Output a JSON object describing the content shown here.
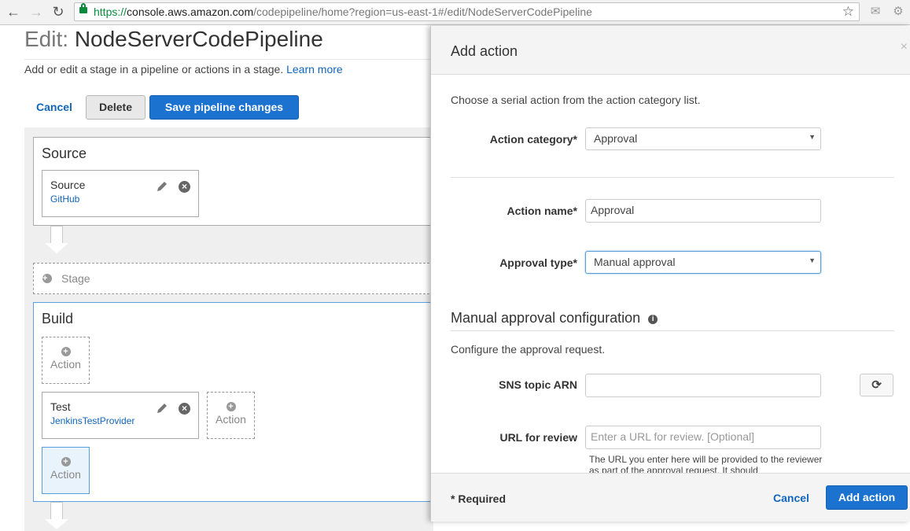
{
  "browser": {
    "url_scheme": "https://",
    "url_host": "console.aws.amazon.com",
    "url_path": "/codepipeline/home?region=us-east-1#/edit/NodeServerCodePipeline"
  },
  "page": {
    "title_prefix": "Edit: ",
    "title_name": "NodeServerCodePipeline",
    "subtitle": "Add or edit a stage in a pipeline or actions in a stage.",
    "learn_more": "Learn more",
    "cancel": "Cancel",
    "delete": "Delete",
    "save": "Save pipeline changes"
  },
  "pipeline": {
    "source_stage": {
      "title": "Source",
      "action_title": "Source",
      "action_provider": "GitHub"
    },
    "add_stage_label": "Stage",
    "build_stage": {
      "title": "Build",
      "action_title": "Test",
      "action_provider": "JenkinsTestProvider"
    },
    "add_action_label": "Action"
  },
  "modal": {
    "title": "Add action",
    "close": "×",
    "intro": "Choose a serial action from the action category list.",
    "category_label": "Action category*",
    "category_value": "Approval",
    "name_label": "Action name*",
    "name_value": "Approval",
    "approval_type_label": "Approval type*",
    "approval_type_value": "Manual approval",
    "section_title": "Manual approval configuration",
    "section_sub": "Configure the approval request.",
    "sns_label": "SNS topic ARN",
    "sns_value": "",
    "url_label": "URL for review",
    "url_placeholder": "Enter a URL for review. [Optional]",
    "help_text": "The URL you enter here will be provided to the reviewer as part of the approval request. It should",
    "required_note": "* Required",
    "cancel": "Cancel",
    "add": "Add action"
  }
}
